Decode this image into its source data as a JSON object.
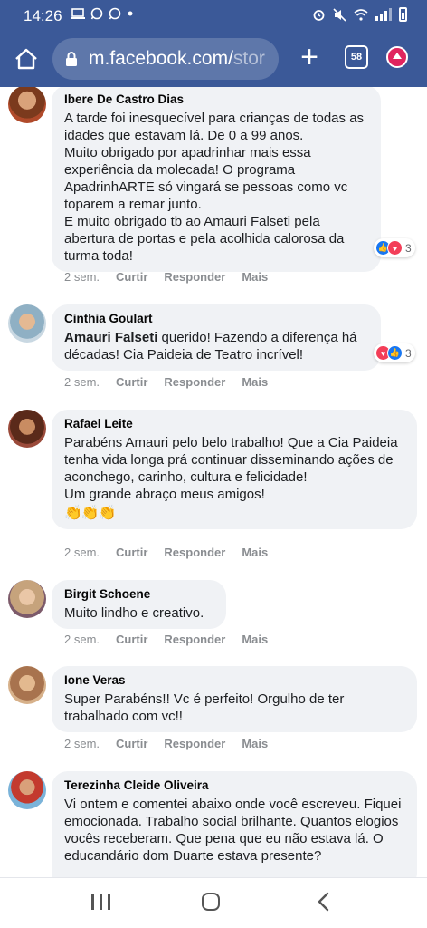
{
  "status_bar": {
    "time": "14:26",
    "left_icons": [
      "laptop-icon",
      "whatsapp-icon",
      "whatsapp-icon",
      "dot-icon"
    ],
    "right_icons": [
      "alarm-icon",
      "mute-icon",
      "wifi-icon",
      "signal-icon",
      "battery-icon"
    ]
  },
  "browser": {
    "url_main": "m.facebook.com/",
    "url_rest": "stor",
    "tab_count": "58",
    "colors": {
      "toolbar": "#3b5998",
      "bubble": "#f0f2f5"
    }
  },
  "comments": [
    {
      "author": "Ibere De Castro Dias",
      "text": "A tarde foi inesquecível para crianças de todas as idades que estavam lá. De 0 a 99 anos.\nMuito obrigado por apadrinhar mais essa experiência da molecada! O programa ApadrinhARTE só vingará se pessoas como vc toparem a remar junto.\nE muito obrigado tb ao Amauri Falseti pela abertura de portas e pela acolhida calorosa da turma toda!",
      "time": "2 sem.",
      "like": "Curtir",
      "reply": "Responder",
      "more": "Mais",
      "reaction_count": "3",
      "reaction_icons": [
        "like-icon",
        "love-icon"
      ]
    },
    {
      "author": "Cinthia Goulart",
      "mention": "Amauri Falseti",
      "text": " querido! Fazendo a diferença há décadas! Cia Paideia de Teatro incrível!",
      "time": "2 sem.",
      "like": "Curtir",
      "reply": "Responder",
      "more": "Mais",
      "reaction_count": "3",
      "reaction_icons": [
        "love-icon",
        "like-icon"
      ]
    },
    {
      "author": "Rafael Leite",
      "text": "Parabéns Amauri pelo belo trabalho! Que a Cia Paideia tenha vida longa prá continuar disseminando ações de aconchego, carinho, cultura e felicidade!\nUm grande abraço meus amigos!",
      "emoji": "👏👏👏",
      "time": "2 sem.",
      "like": "Curtir",
      "reply": "Responder",
      "more": "Mais"
    },
    {
      "author": "Birgit Schoene",
      "text": "Muito lindho e creativo.",
      "time": "2 sem.",
      "like": "Curtir",
      "reply": "Responder",
      "more": "Mais"
    },
    {
      "author": "Ione Veras",
      "text": "Super Parabéns!! Vc é perfeito! Orgulho de ter trabalhado com vc!!",
      "time": "2 sem.",
      "like": "Curtir",
      "reply": "Responder",
      "more": "Mais"
    },
    {
      "author": "Terezinha Cleide Oliveira",
      "text": "Vi ontem e comentei abaixo onde você escreveu. Fiquei emocionada. Trabalho social brilhante. Quantos elogios vocês receberam. Que pena que eu não estava lá. O educandário dom Duarte estava presente?"
    }
  ],
  "nav_bar": {
    "buttons": [
      "recent-apps-icon",
      "home-icon",
      "back-icon"
    ]
  }
}
